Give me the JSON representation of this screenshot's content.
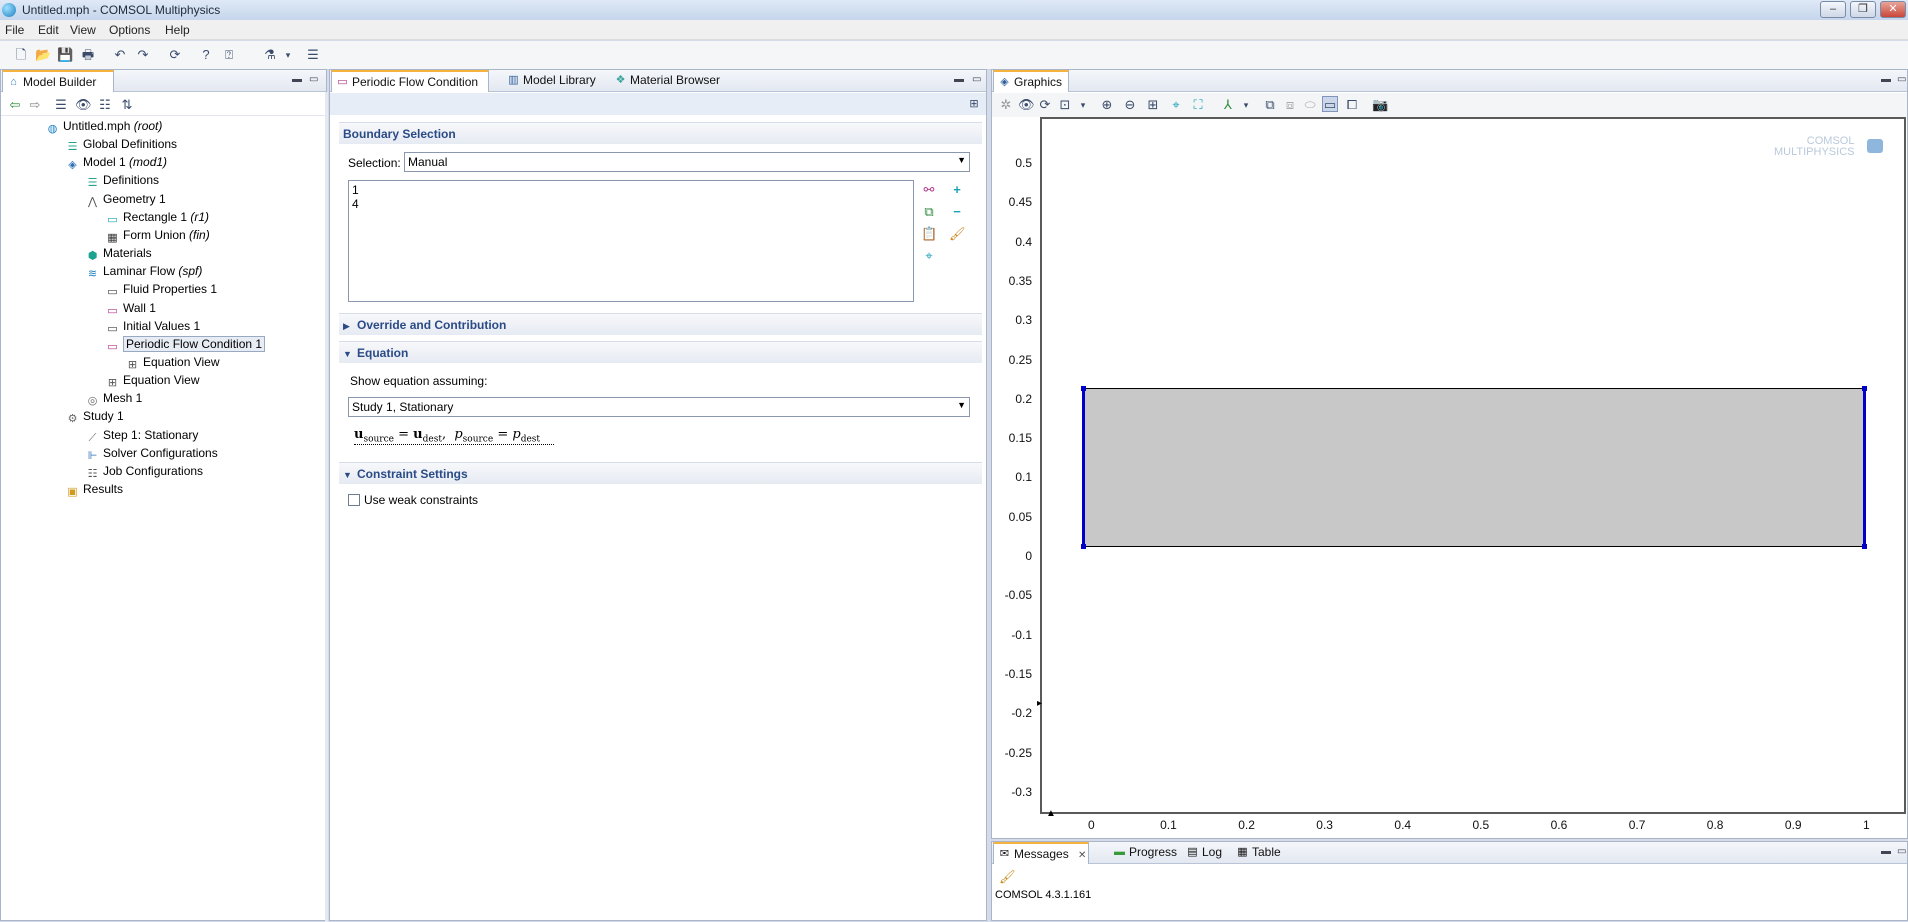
{
  "window": {
    "title": "Untitled.mph - COMSOL Multiphysics"
  },
  "menu": [
    "File",
    "Edit",
    "View",
    "Options",
    "Help"
  ],
  "icons": {
    "app": "comsol-logo-icon",
    "toolbar": [
      "new-file-icon",
      "open-icon",
      "save-icon",
      "print-icon",
      "undo-icon",
      "redo-icon",
      "compact-history-icon",
      "help-icon",
      "dynamic-help-icon",
      "physics-icon",
      "physics-dropdown-icon",
      "layout-icon"
    ]
  },
  "model_builder": {
    "tab": "Model Builder",
    "tree": [
      {
        "label": "Untitled.mph",
        "tag": "(root)",
        "icon": "mph-file-icon",
        "depth": 0
      },
      {
        "label": "Global Definitions",
        "tag": "",
        "icon": "definitions-icon",
        "depth": 1
      },
      {
        "label": "Model 1",
        "tag": "(mod1)",
        "icon": "model-icon",
        "depth": 1
      },
      {
        "label": "Definitions",
        "tag": "",
        "icon": "definitions-icon",
        "depth": 2
      },
      {
        "label": "Geometry 1",
        "tag": "",
        "icon": "geometry-icon",
        "depth": 2
      },
      {
        "label": "Rectangle 1",
        "tag": "(r1)",
        "icon": "rectangle-icon",
        "depth": 3
      },
      {
        "label": "Form Union",
        "tag": "(fin)",
        "icon": "form-union-icon",
        "depth": 3
      },
      {
        "label": "Materials",
        "tag": "",
        "icon": "materials-icon",
        "depth": 2
      },
      {
        "label": "Laminar Flow",
        "tag": "(spf)",
        "icon": "laminar-flow-icon",
        "depth": 2
      },
      {
        "label": "Fluid Properties 1",
        "tag": "",
        "icon": "domain-feature-icon",
        "depth": 3
      },
      {
        "label": "Wall 1",
        "tag": "",
        "icon": "boundary-feature-icon",
        "depth": 3
      },
      {
        "label": "Initial Values 1",
        "tag": "",
        "icon": "domain-feature-icon",
        "depth": 3
      },
      {
        "label": "Periodic Flow Condition 1",
        "tag": "",
        "icon": "periodic-condition-icon",
        "depth": 3,
        "selected": true
      },
      {
        "label": "Equation View",
        "tag": "",
        "icon": "equation-view-icon",
        "depth": 4
      },
      {
        "label": "Equation View",
        "tag": "",
        "icon": "equation-view-icon",
        "depth": 3
      },
      {
        "label": "Mesh 1",
        "tag": "",
        "icon": "mesh-icon",
        "depth": 2
      },
      {
        "label": "Study 1",
        "tag": "",
        "icon": "study-icon",
        "depth": 1
      },
      {
        "label": "Step 1: Stationary",
        "tag": "",
        "icon": "study-step-icon",
        "depth": 2
      },
      {
        "label": "Solver Configurations",
        "tag": "",
        "icon": "solver-icon",
        "depth": 2
      },
      {
        "label": "Job Configurations",
        "tag": "",
        "icon": "job-icon",
        "depth": 2
      },
      {
        "label": "Results",
        "tag": "",
        "icon": "results-icon",
        "depth": 1
      }
    ]
  },
  "settings": {
    "tabs": [
      "Periodic Flow Condition",
      "Model Library",
      "Material Browser"
    ],
    "boundary_selection": {
      "header": "Boundary Selection",
      "selection_label": "Selection:",
      "selection_value": "Manual",
      "items": [
        "1",
        "4"
      ]
    },
    "override_header": "Override and Contribution",
    "equation": {
      "header": "Equation",
      "show_label": "Show equation assuming:",
      "study_value": "Study 1, Stationary",
      "formula_u": "u",
      "sub_source": "source",
      "eq": "=",
      "sub_dest": "dest",
      "formula_p": "p",
      "comma": ","
    },
    "constraint": {
      "header": "Constraint Settings",
      "weak_label": "Use weak constraints",
      "weak_checked": false
    }
  },
  "graphics": {
    "tab": "Graphics",
    "watermark": [
      "COMSOL",
      "MULTIPHYSICS"
    ],
    "y_ticks": [
      "0.5",
      "0.45",
      "0.4",
      "0.35",
      "0.3",
      "0.25",
      "0.2",
      "0.15",
      "0.1",
      "0.05",
      "0",
      "-0.05",
      "-0.1",
      "-0.15",
      "-0.2",
      "-0.25",
      "-0.3"
    ],
    "x_ticks": [
      "0",
      "0.1",
      "0.2",
      "0.3",
      "0.4",
      "0.5",
      "0.6",
      "0.7",
      "0.8",
      "0.9",
      "1"
    ],
    "colors": {
      "domain": "#c8c8c8",
      "selected_edge": "#0000c8",
      "edge": "#000000"
    }
  },
  "messages": {
    "tabs": [
      "Messages",
      "Progress",
      "Log",
      "Table"
    ],
    "text": "COMSOL 4.3.1.161"
  }
}
